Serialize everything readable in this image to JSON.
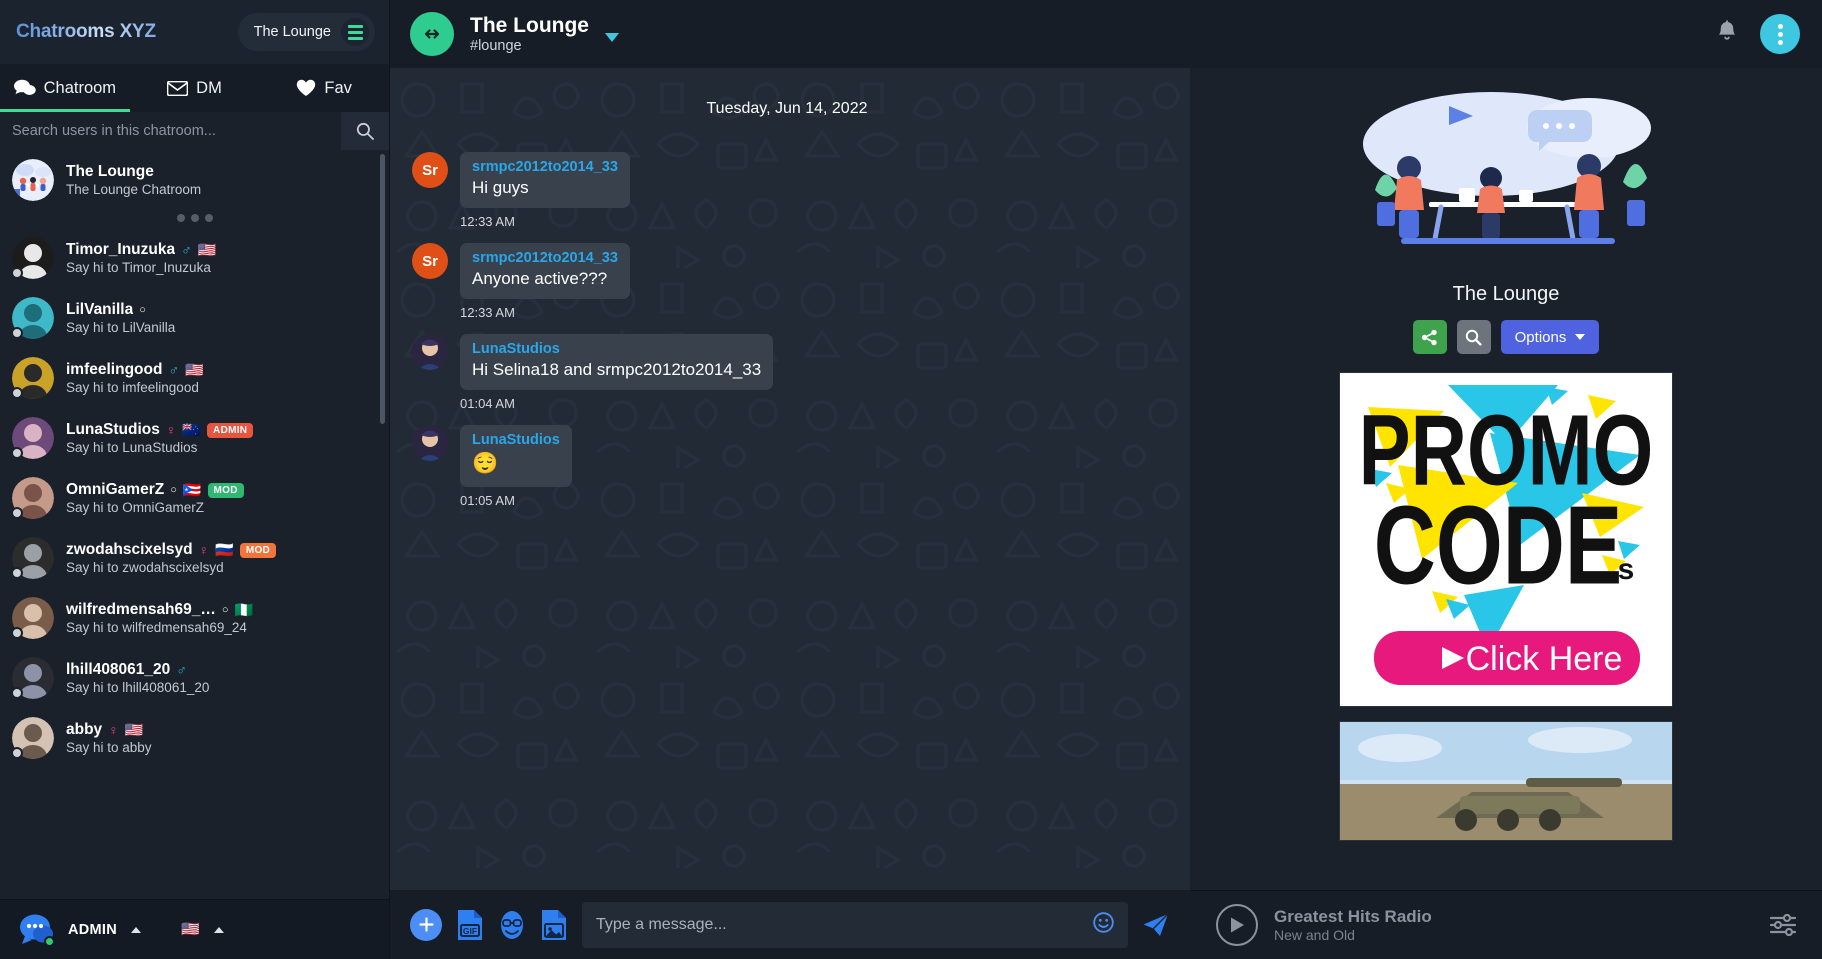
{
  "app": {
    "brand": "Chatrooms XYZ",
    "room_pill_label": "The Lounge"
  },
  "tabs": [
    {
      "label": "Chatroom",
      "icon": "chat-bubbles-icon",
      "active": true
    },
    {
      "label": "DM",
      "icon": "envelope-icon",
      "active": false
    },
    {
      "label": "Fav",
      "icon": "heart-icon",
      "active": false
    }
  ],
  "search": {
    "placeholder": "Search users in this chatroom...",
    "value": "",
    "icon": "search-icon"
  },
  "sidebar": {
    "room_entry": {
      "name": "The Lounge",
      "subtitle": "The Lounge Chatroom"
    },
    "users": [
      {
        "name": "Timor_Inuzuka",
        "subtitle": "Say hi to Timor_Inuzuka",
        "gender": "male",
        "flag": "🇺🇸",
        "badge": "",
        "badge_color": ""
      },
      {
        "name": "LilVanilla",
        "subtitle": "Say hi to LilVanilla",
        "gender": "none",
        "flag": "",
        "badge": "",
        "badge_color": ""
      },
      {
        "name": "imfeelingood",
        "subtitle": "Say hi to imfeelingood",
        "gender": "male",
        "flag": "🇺🇸",
        "badge": "",
        "badge_color": ""
      },
      {
        "name": "LunaStudios",
        "subtitle": "Say hi to LunaStudios",
        "gender": "female",
        "flag": "🇳🇿",
        "badge": "ADMIN",
        "badge_color": "#e8553f"
      },
      {
        "name": "OmniGamerZ",
        "subtitle": "Say hi to OmniGamerZ",
        "gender": "none",
        "flag": "🇵🇷",
        "badge": "MOD",
        "badge_color": "#2eb872"
      },
      {
        "name": "zwodahscixelsyd",
        "subtitle": "Say hi to zwodahscixelsyd",
        "gender": "female",
        "flag": "🇷🇺",
        "badge": "MOD",
        "badge_color": "#f2743a"
      },
      {
        "name": "wilfredmensah69_…",
        "subtitle": "Say hi to wilfredmensah69_24",
        "gender": "none",
        "flag": "🇳🇬",
        "badge": "",
        "badge_color": ""
      },
      {
        "name": "lhill408061_20",
        "subtitle": "Say hi to lhill408061_20",
        "gender": "male",
        "flag": "",
        "badge": "",
        "badge_color": ""
      },
      {
        "name": "abby",
        "subtitle": "Say hi to abby",
        "gender": "female",
        "flag": "🇺🇸",
        "badge": "",
        "badge_color": ""
      }
    ],
    "footer": {
      "username": "ADMIN",
      "flag": "🇺🇸"
    }
  },
  "chat_header": {
    "title": "The Lounge",
    "channel": "#lounge",
    "avatar_icon": "arrows-horizontal-icon",
    "dropdown_icon": "caret-down-icon"
  },
  "chat": {
    "day_separator": "Tuesday, Jun 14, 2022",
    "messages": [
      {
        "user": "srmpc2012to2014_33",
        "text": "Hi guys",
        "time": "12:33 AM",
        "avatar_kind": "initials",
        "initials": "Sr",
        "is_emoji": false
      },
      {
        "user": "srmpc2012to2014_33",
        "text": "Anyone active???",
        "time": "12:33 AM",
        "avatar_kind": "initials",
        "initials": "Sr",
        "is_emoji": false
      },
      {
        "user": "LunaStudios",
        "text": "Hi Selina18 and srmpc2012to2014_33",
        "time": "01:04 AM",
        "avatar_kind": "photo",
        "initials": "",
        "is_emoji": false
      },
      {
        "user": "LunaStudios",
        "text": "😌",
        "time": "01:05 AM",
        "avatar_kind": "photo",
        "initials": "",
        "is_emoji": true
      }
    ]
  },
  "composer": {
    "placeholder": "Type a message...",
    "value": "",
    "tools": [
      {
        "name": "add-attachment-icon",
        "label": "+"
      },
      {
        "name": "gif-icon",
        "label": "GIF"
      },
      {
        "name": "sticker-icon",
        "label": "sticker"
      },
      {
        "name": "image-icon",
        "label": "image"
      }
    ],
    "emoji_icon": "smiley-icon",
    "send_icon": "send-icon"
  },
  "right_header": {
    "bell_icon": "bell-icon",
    "kebab_icon": "more-vertical-icon"
  },
  "right_panel": {
    "room_title": "The Lounge",
    "buttons": {
      "share_label": "share",
      "search_label": "search",
      "options_label": "Options"
    },
    "ad": {
      "line1": "PROMO",
      "line2": "CODE",
      "line2_suffix": "s",
      "cta": "Click Here"
    }
  },
  "radio": {
    "title": "Greatest Hits Radio",
    "subtitle": "New and Old",
    "play_icon": "play-circle-icon",
    "eq_icon": "equalizer-icon"
  },
  "colors": {
    "accent_green": "#3ddc97",
    "accent_cyan": "#3ec7e0",
    "link_blue": "#29a7e8",
    "options_blue": "#4f63e0",
    "share_green": "#3fa34d"
  }
}
